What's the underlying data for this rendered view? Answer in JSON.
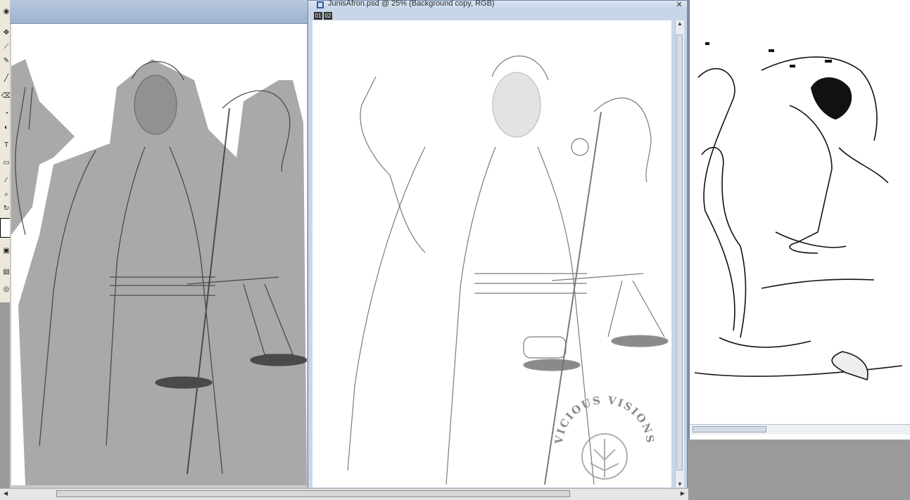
{
  "document_window": {
    "title": "JunisAfron.psd @ 25% (Background copy, RGB)",
    "tab_chips": [
      "01",
      "02"
    ]
  },
  "watermark": {
    "text": "VICIOUS VISIONS"
  },
  "colors": {
    "desktop": "#9a9a9a",
    "titlebar": "#c3d3e8",
    "canvas": "#ffffff",
    "mask_gray": "#a9a9a9"
  },
  "icons": [
    "move-icon",
    "lasso-icon",
    "brush-icon",
    "eraser-icon",
    "pen-icon",
    "zoom-icon",
    "hand-icon",
    "close-icon"
  ]
}
